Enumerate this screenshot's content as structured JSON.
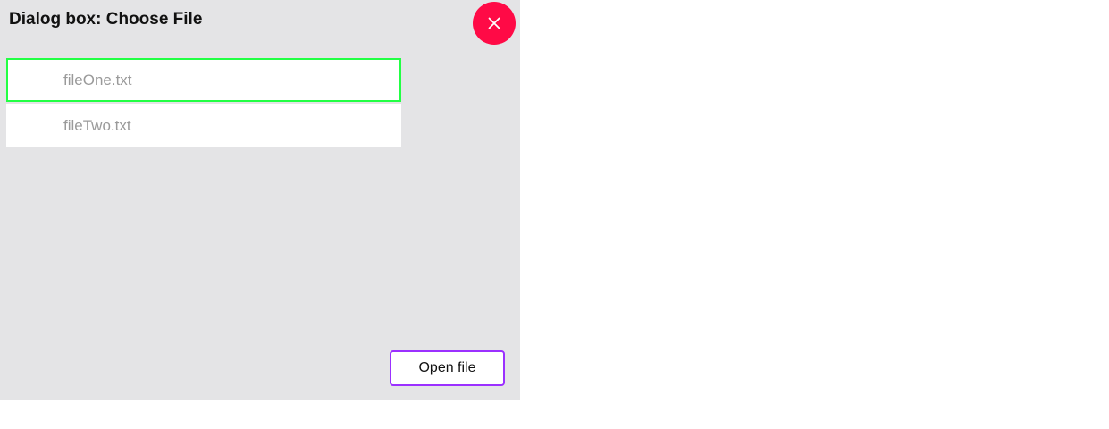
{
  "dialog": {
    "title": "Dialog box: Choose File",
    "background": "#e4e4e6",
    "close_icon": "close-icon",
    "close_color": "#ff0a46",
    "files": [
      {
        "name": "fileOne.txt",
        "selected": true
      },
      {
        "name": "fileTwo.txt",
        "selected": false
      }
    ],
    "selection_color": "#22ff44",
    "open_label": "Open file",
    "open_border_color": "#9b30ff"
  }
}
